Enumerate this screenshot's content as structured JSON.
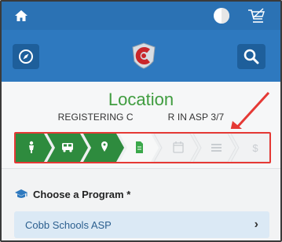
{
  "colors": {
    "topbar": "#2b72b4",
    "header": "#2e79bf",
    "title_green": "#3f9c3f",
    "step_done": "#2e8b3e",
    "step_current": "#3aa84a",
    "step_pending": "#f1f2f3",
    "annotation_red": "#e53935"
  },
  "topbar": {
    "home_icon": "home-icon",
    "toggle_icon": "theme-toggle-icon",
    "cart_icon": "cart-icon"
  },
  "header": {
    "left_icon": "compass-icon",
    "right_icon": "search-icon",
    "logo_icon": "cobb-c-logo"
  },
  "page": {
    "title": "Location",
    "subtitle_prefix": "REGISTERING C",
    "subtitle_suffix": "R IN ASP 3/7"
  },
  "steps": [
    {
      "icon": "person-icon",
      "state": "done"
    },
    {
      "icon": "bus-icon",
      "state": "done"
    },
    {
      "icon": "map-pin-icon",
      "state": "done"
    },
    {
      "icon": "document-icon",
      "state": "current"
    },
    {
      "icon": "calendar-icon",
      "state": "pending"
    },
    {
      "icon": "list-icon",
      "state": "pending"
    },
    {
      "icon": "dollar-icon",
      "state": "pending"
    }
  ],
  "program_section": {
    "label": "Choose a Program *",
    "icon": "graduation-cap-icon",
    "selected_program": "Cobb Schools ASP"
  }
}
